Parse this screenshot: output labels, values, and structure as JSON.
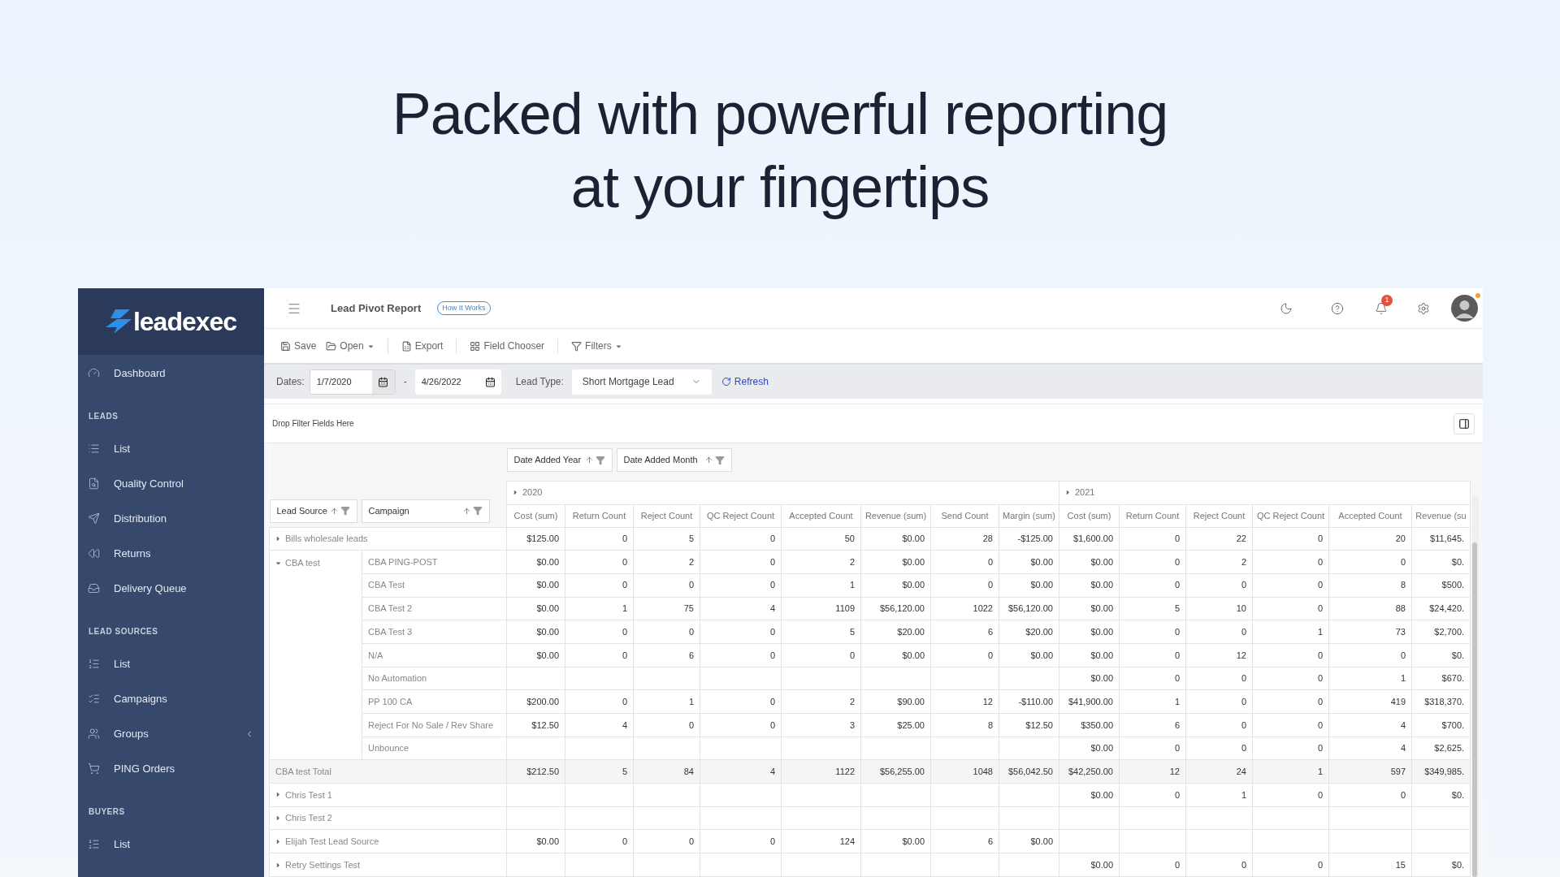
{
  "headline_lines": [
    "Packed with powerful reporting",
    "at your fingertips"
  ],
  "sidebar": {
    "logo": "leadexec",
    "top_items": [
      {
        "label": "Dashboard"
      }
    ],
    "sections": [
      {
        "title": "LEADS",
        "items": [
          {
            "label": "List",
            "kind": "link"
          },
          {
            "label": "Quality Control",
            "kind": "link"
          },
          {
            "label": "Distribution",
            "kind": "link"
          },
          {
            "label": "Returns",
            "kind": "link"
          },
          {
            "label": "Delivery Queue",
            "kind": "link"
          }
        ]
      },
      {
        "title": "LEAD SOURCES",
        "items": [
          {
            "label": "List",
            "kind": "link"
          },
          {
            "label": "Campaigns",
            "kind": "link"
          },
          {
            "label": "Groups",
            "kind": "submenu"
          },
          {
            "label": "PING Orders",
            "kind": "link"
          }
        ]
      },
      {
        "title": "BUYERS",
        "items": [
          {
            "label": "List",
            "kind": "link"
          }
        ]
      }
    ]
  },
  "header": {
    "title": "Lead Pivot Report",
    "help_link": "How It Works",
    "notification_count": "1"
  },
  "toolbar": [
    [
      {
        "label": "Save",
        "dropdown": false
      },
      {
        "label": "Open",
        "dropdown": true
      }
    ],
    [
      {
        "label": "Export",
        "dropdown": false
      }
    ],
    [
      {
        "label": "Field Chooser",
        "dropdown": false
      }
    ],
    [
      {
        "label": "Filters",
        "dropdown": true
      }
    ]
  ],
  "filters": {
    "dates_label": "Dates:",
    "start_date": "1/7/2020",
    "separator": "-",
    "end_date": "4/26/2022",
    "lead_type_label": "Lead Type:",
    "lead_type": "Short Mortgage Lead",
    "refresh": "Refresh"
  },
  "pivot": {
    "drop_zone": "Drop Filter Fields Here",
    "column_fields": [
      "Date Added Year",
      "Date Added Month"
    ],
    "row_fields": [
      "Lead Source",
      "Campaign"
    ],
    "years": [
      {
        "label": "2020",
        "expanded": false,
        "columns": [
          "Cost (sum)",
          "Return Count",
          "Reject Count",
          "QC Reject Count",
          "Accepted Count",
          "Revenue (sum)",
          "Send Count",
          "Margin (sum)"
        ]
      },
      {
        "label": "2021",
        "expanded": false,
        "columns": [
          "Cost (sum)",
          "Return Count",
          "Reject Count",
          "QC Reject Count",
          "Accepted Count",
          "Revenue (su"
        ]
      }
    ],
    "rows": [
      {
        "kind": "source",
        "label": "Bills wholesale leads",
        "expanded": false,
        "cells": [
          "$125.00",
          "0",
          "5",
          "0",
          "50",
          "$0.00",
          "28",
          "-$125.00",
          "$1,600.00",
          "0",
          "22",
          "0",
          "20",
          "$11,645."
        ]
      },
      {
        "kind": "group",
        "label": "CBA test",
        "expanded": true,
        "children": [
          {
            "label": "CBA PING-POST",
            "cells": [
              "$0.00",
              "0",
              "2",
              "0",
              "2",
              "$0.00",
              "0",
              "$0.00",
              "$0.00",
              "0",
              "2",
              "0",
              "0",
              "$0."
            ]
          },
          {
            "label": "CBA Test",
            "cells": [
              "$0.00",
              "0",
              "0",
              "0",
              "1",
              "$0.00",
              "0",
              "$0.00",
              "$0.00",
              "0",
              "0",
              "0",
              "8",
              "$500."
            ]
          },
          {
            "label": "CBA Test 2",
            "cells": [
              "$0.00",
              "1",
              "75",
              "4",
              "1109",
              "$56,120.00",
              "1022",
              "$56,120.00",
              "$0.00",
              "5",
              "10",
              "0",
              "88",
              "$24,420."
            ]
          },
          {
            "label": "CBA Test 3",
            "cells": [
              "$0.00",
              "0",
              "0",
              "0",
              "5",
              "$20.00",
              "6",
              "$20.00",
              "$0.00",
              "0",
              "0",
              "1",
              "73",
              "$2,700."
            ]
          },
          {
            "label": "N/A",
            "cells": [
              "$0.00",
              "0",
              "6",
              "0",
              "0",
              "$0.00",
              "0",
              "$0.00",
              "$0.00",
              "0",
              "12",
              "0",
              "0",
              "$0."
            ]
          },
          {
            "label": "No Automation",
            "cells": [
              null,
              null,
              null,
              null,
              null,
              null,
              null,
              null,
              "$0.00",
              "0",
              "0",
              "0",
              "1",
              "$670."
            ]
          },
          {
            "label": "PP 100 CA",
            "cells": [
              "$200.00",
              "0",
              "1",
              "0",
              "2",
              "$90.00",
              "12",
              "-$110.00",
              "$41,900.00",
              "1",
              "0",
              "0",
              "419",
              "$318,370."
            ]
          },
          {
            "label": "Reject For No Sale / Rev Share",
            "cells": [
              "$12.50",
              "4",
              "0",
              "0",
              "3",
              "$25.00",
              "8",
              "$12.50",
              "$350.00",
              "6",
              "0",
              "0",
              "4",
              "$700."
            ]
          },
          {
            "label": "Unbounce",
            "cells": [
              null,
              null,
              null,
              null,
              null,
              null,
              null,
              null,
              "$0.00",
              "0",
              "0",
              "0",
              "4",
              "$2,625."
            ]
          }
        ]
      },
      {
        "kind": "total",
        "label": "CBA test Total",
        "cells": [
          "$212.50",
          "5",
          "84",
          "4",
          "1122",
          "$56,255.00",
          "1048",
          "$56,042.50",
          "$42,250.00",
          "12",
          "24",
          "1",
          "597",
          "$349,985."
        ]
      },
      {
        "kind": "source",
        "label": "Chris Test 1",
        "expanded": false,
        "cells": [
          null,
          null,
          null,
          null,
          null,
          null,
          null,
          null,
          "$0.00",
          "0",
          "1",
          "0",
          "0",
          "$0."
        ]
      },
      {
        "kind": "source",
        "label": "Chris Test 2",
        "expanded": false,
        "cells": [
          null,
          null,
          null,
          null,
          null,
          null,
          null,
          null,
          null,
          null,
          null,
          null,
          null,
          null
        ]
      },
      {
        "kind": "source",
        "label": "Elijah Test Lead Source",
        "expanded": false,
        "cells": [
          "$0.00",
          "0",
          "0",
          "0",
          "124",
          "$0.00",
          "6",
          "$0.00",
          null,
          null,
          null,
          null,
          null,
          null
        ]
      },
      {
        "kind": "source",
        "label": "Retry Settings Test",
        "expanded": false,
        "cells": [
          null,
          null,
          null,
          null,
          null,
          null,
          null,
          null,
          "$0.00",
          "0",
          "0",
          "0",
          "15",
          "$0."
        ]
      }
    ]
  }
}
